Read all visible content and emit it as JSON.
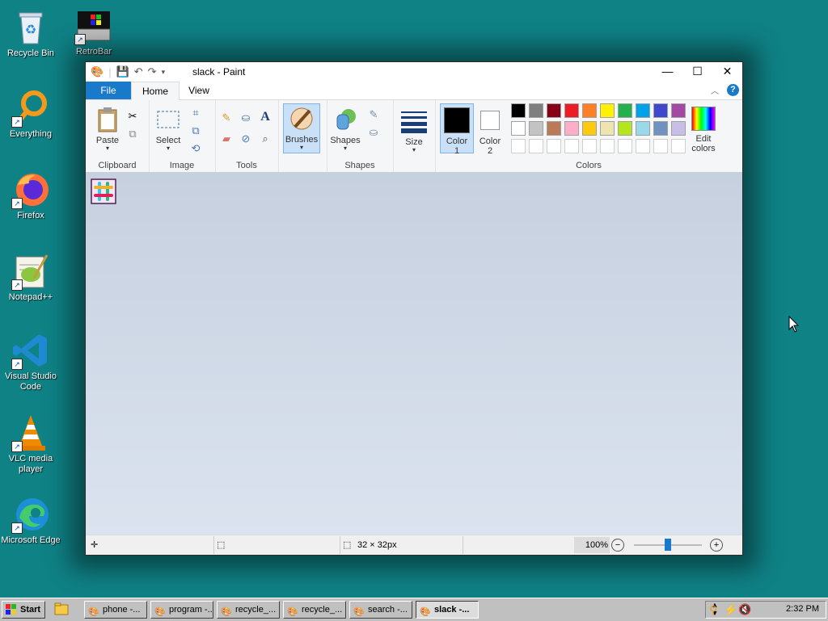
{
  "desktop": {
    "icons": [
      {
        "label": "Recycle Bin"
      },
      {
        "label": "RetroBar"
      },
      {
        "label": "Everything"
      },
      {
        "label": "Firefox"
      },
      {
        "label": "Notepad++"
      },
      {
        "label": "Visual Studio Code"
      },
      {
        "label": "VLC media player"
      },
      {
        "label": "Microsoft Edge"
      }
    ]
  },
  "window": {
    "title": "slack - Paint",
    "tabs": {
      "file": "File",
      "home": "Home",
      "view": "View"
    },
    "help": "?",
    "groups": {
      "clipboard": {
        "label": "Clipboard",
        "paste": "Paste"
      },
      "image": {
        "label": "Image",
        "select": "Select"
      },
      "tools": {
        "label": "Tools"
      },
      "brushes": {
        "label": "Brushes"
      },
      "shapes": {
        "label": "Shapes",
        "shapes_btn": "Shapes"
      },
      "size": {
        "label": "Size"
      },
      "color1": {
        "label": "Color",
        "num": "1"
      },
      "color2": {
        "label": "Color",
        "num": "2"
      },
      "colors": {
        "label": "Colors",
        "edit_line1": "Edit",
        "edit_line2": "colors"
      }
    },
    "palette_row1": [
      "#000000",
      "#7f7f7f",
      "#880015",
      "#ed1c24",
      "#ff7f27",
      "#fff200",
      "#22b14c",
      "#00a2e8",
      "#3f48cc",
      "#a349a4"
    ],
    "palette_row2": [
      "#ffffff",
      "#c3c3c3",
      "#b97a57",
      "#ffaec9",
      "#ffc90e",
      "#efe4b0",
      "#b5e61d",
      "#99d9ea",
      "#7092be",
      "#c8bfe7"
    ],
    "color1_value": "#000000",
    "color2_value": "#ffffff",
    "status": {
      "size": "32 × 32px",
      "zoom": "100%"
    }
  },
  "taskbar": {
    "start": "Start",
    "buttons": [
      {
        "label": "phone -..."
      },
      {
        "label": "program -..."
      },
      {
        "label": "recycle_..."
      },
      {
        "label": "recycle_..."
      },
      {
        "label": "search -..."
      },
      {
        "label": "slack -..."
      }
    ],
    "clock": "2:32 PM"
  }
}
